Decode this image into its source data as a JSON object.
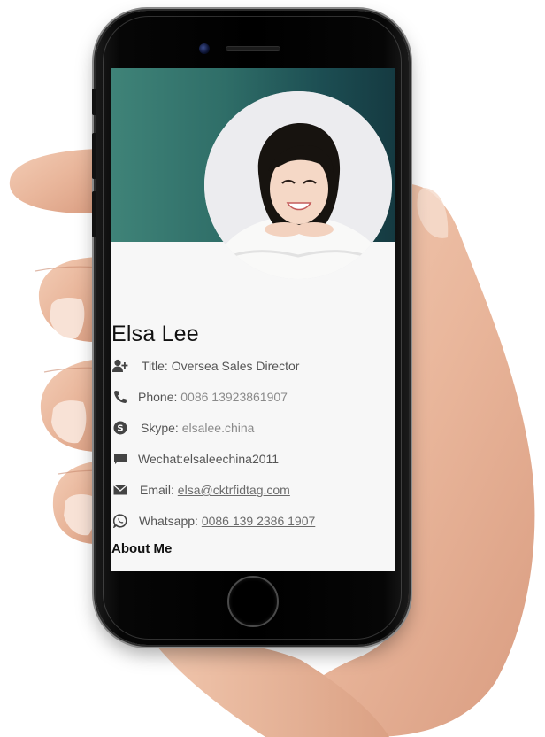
{
  "profile": {
    "name": "Elsa Lee",
    "title_label": "Title: ",
    "title_value": "Oversea Sales Director",
    "phone_label": "Phone: ",
    "phone_value": "0086 13923861907",
    "skype_label": "Skype: ",
    "skype_value": "elsalee.china",
    "wechat_label": "Wechat:",
    "wechat_value": "elsaleechina2011",
    "email_label": "Email: ",
    "email_value": "elsa@cktrfidtag.com",
    "whatsapp_label": "Whatsapp: ",
    "whatsapp_value": "0086 139 2386 1907",
    "about_heading": "About Me"
  },
  "icons": {
    "title": "add-user-icon",
    "phone": "phone-icon",
    "skype": "skype-icon",
    "wechat": "chat-bubble-icon",
    "email": "envelope-icon",
    "whatsapp": "whatsapp-icon"
  },
  "colors": {
    "banner_start": "#3f8378",
    "banner_end": "#153a41",
    "screen_bg": "#f7f7f7",
    "text_dark": "#111111",
    "text_muted": "#555555"
  }
}
